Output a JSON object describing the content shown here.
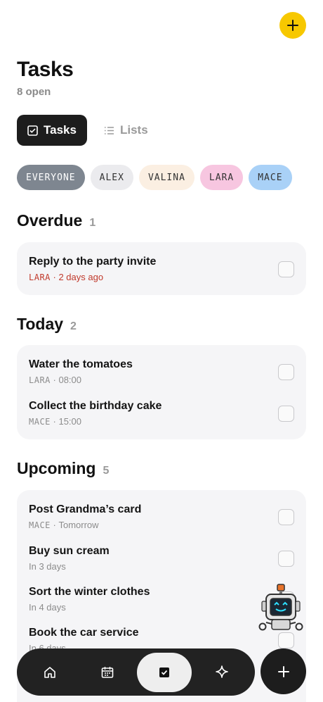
{
  "header": {
    "title": "Tasks",
    "subtitle": "8 open",
    "add_icon": "plus-icon",
    "accent": "#f7c800"
  },
  "tabs": [
    {
      "label": "Tasks",
      "icon": "checkbox-icon",
      "active": true
    },
    {
      "label": "Lists",
      "icon": "list-icon",
      "active": false
    }
  ],
  "filters": [
    {
      "label": "EVERYONE",
      "bg": "#7e8690",
      "fg": "#ffffff",
      "selected": true
    },
    {
      "label": "ALEX",
      "bg": "#ebebee",
      "fg": "#333333",
      "selected": false
    },
    {
      "label": "VALINA",
      "bg": "#fbefe2",
      "fg": "#333333",
      "selected": false
    },
    {
      "label": "LARA",
      "bg": "#f7c6e0",
      "fg": "#333333",
      "selected": false
    },
    {
      "label": "MACE",
      "bg": "#a9d1f7",
      "fg": "#333333",
      "selected": false
    }
  ],
  "sections": {
    "overdue": {
      "title": "Overdue",
      "count": "1",
      "tasks": [
        {
          "title": "Reply to the party invite",
          "who": "LARA",
          "when": "2 days ago"
        }
      ]
    },
    "today": {
      "title": "Today",
      "count": "2",
      "tasks": [
        {
          "title": "Water the tomatoes",
          "who": "LARA",
          "when": "08:00"
        },
        {
          "title": "Collect the birthday cake",
          "who": "MACE",
          "when": "15:00"
        }
      ]
    },
    "upcoming": {
      "title": "Upcoming",
      "count": "5",
      "tasks": [
        {
          "title": "Post Grandma’s card",
          "who": "MACE",
          "when": "Tomorrow"
        },
        {
          "title": "Buy sun cream",
          "when": "In 3 days"
        },
        {
          "title": "Sort the winter clothes",
          "when": "In 4 days"
        },
        {
          "title": "Book the car service",
          "when": "In 6 days"
        }
      ]
    }
  },
  "separator": " · ",
  "bottom_nav": [
    {
      "icon": "home-icon",
      "active": false
    },
    {
      "icon": "calendar-icon",
      "active": false
    },
    {
      "icon": "tasks-icon",
      "active": true
    },
    {
      "icon": "sparkle-icon",
      "active": false
    }
  ],
  "fab_icon": "plus-icon",
  "mascot_icon": "robot-icon"
}
